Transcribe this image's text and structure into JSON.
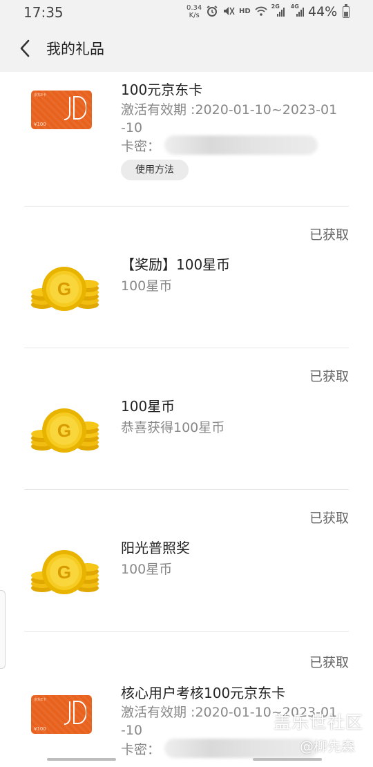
{
  "status_bar": {
    "time": "17:35",
    "net_speed_value": "0.34",
    "net_speed_unit": "K/s",
    "battery": "44%",
    "battery_level": 0.44,
    "icons": [
      "alarm-icon",
      "mute-icon",
      "hd-icon",
      "wifi-icon",
      "signal-2g-icon",
      "signal-4g-icon"
    ],
    "hd_label": "HD",
    "sim1_label": "2G",
    "sim2_label": "4G"
  },
  "header": {
    "title": "我的礼品",
    "back_icon": "chevron-left-icon"
  },
  "gifts": [
    {
      "type": "card",
      "title": "100元京东卡",
      "validity": "激活有效期 :2020-01-10~2023-01-10",
      "secret_label": "卡密：",
      "usage_button": "使用方法",
      "card_amount": "¥100",
      "card_brand": "京东E卡"
    },
    {
      "type": "coin",
      "status": "已获取",
      "title": "【奖励】100星币",
      "subtitle": "100星币",
      "coin_letter": "G"
    },
    {
      "type": "coin",
      "status": "已获取",
      "title": "100星币",
      "subtitle": "恭喜获得100星币",
      "coin_letter": "G"
    },
    {
      "type": "coin",
      "status": "已获取",
      "title": "阳光普照奖",
      "subtitle": "100星币",
      "coin_letter": "G"
    },
    {
      "type": "card",
      "status": "已获取",
      "title": "核心用户考核100元京东卡",
      "validity": "激活有效期 :2020-01-10~2023-01-10",
      "secret_label": "卡密：",
      "card_amount": "¥100",
      "card_brand": "京东E卡"
    }
  ],
  "watermark": {
    "line1": "盖乐世社区",
    "line2": "@柳先森"
  },
  "colors": {
    "header_bg": "#f2f2f2",
    "jd_orange": "#e8621e",
    "coin_gold": "#f5c518",
    "text_secondary": "#888888"
  }
}
